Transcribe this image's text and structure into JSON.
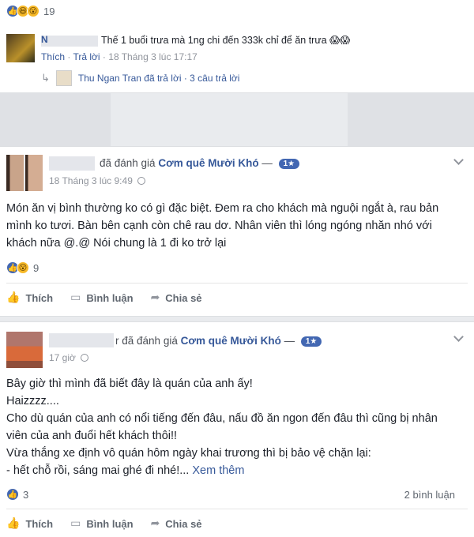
{
  "top_comment_block": {
    "reactions": {
      "icons": [
        "like",
        "haha",
        "wow"
      ],
      "count": "19"
    },
    "comment": {
      "name_initial": "N",
      "text": "Thế 1 buổi trưa mà 1ng chi đến 333k chỉ để ăn trưa 😱😱",
      "actions": [
        "Thích",
        "Trả lời"
      ],
      "timestamp": "18 Tháng 3 lúc 17:17"
    },
    "reply_summary": {
      "text": "Thu Ngan Tran đã trả lời · 3 câu trả lời"
    }
  },
  "post_1": {
    "header": {
      "verb": "đã đánh giá",
      "page_name": "Cơm quê Mười Khó",
      "separator": "—",
      "rating": "1★"
    },
    "timestamp": "18 Tháng 3 lúc 9:49",
    "body": [
      "Món ăn vị bình thường ko có gì đặc biệt. Đem ra cho khách mà nguội ngắt à, rau bản mình ko tươi. Bàn bên cạnh còn chê rau dơ. Nhân viên thì lóng ngóng nhăn nhó với khách nữa @.@ Nói chung là 1 đi ko trở lại"
    ],
    "reactions": {
      "icons": [
        "like",
        "wow"
      ],
      "count": "9"
    },
    "actions": {
      "like": "Thích",
      "comment": "Bình luận",
      "share": "Chia sẻ"
    }
  },
  "post_2": {
    "header": {
      "name_suffix": "r",
      "verb": "đã đánh giá",
      "page_name": "Cơm quê Mười Khó",
      "separator": "—",
      "rating": "1★"
    },
    "timestamp": "17 giờ",
    "body": [
      "Bây giờ thì mình đã biết đây là quán của anh ấy!",
      "Haizzzz....",
      "Cho dù quán của anh có nổi tiếng đến đâu, nấu đồ ăn ngon đến đâu thì cũng bị nhân viên của anh đuổi hết khách thôi!!",
      "Vừa thắng xe định vô quán hôm ngày khai trương thì bị bảo vệ chặn lại:",
      "- hết chỗ rồi, sáng mai ghé đi nhé!..."
    ],
    "see_more": "Xem thêm",
    "reactions": {
      "icons": [
        "like"
      ],
      "count": "3"
    },
    "comment_count": "2 bình luận",
    "actions": {
      "like": "Thích",
      "comment": "Bình luận",
      "share": "Chia sẻ"
    }
  },
  "colors": {
    "link": "#365899",
    "meta": "#90949c",
    "like_blue": "#4267b2",
    "background": "#e9ebee"
  }
}
